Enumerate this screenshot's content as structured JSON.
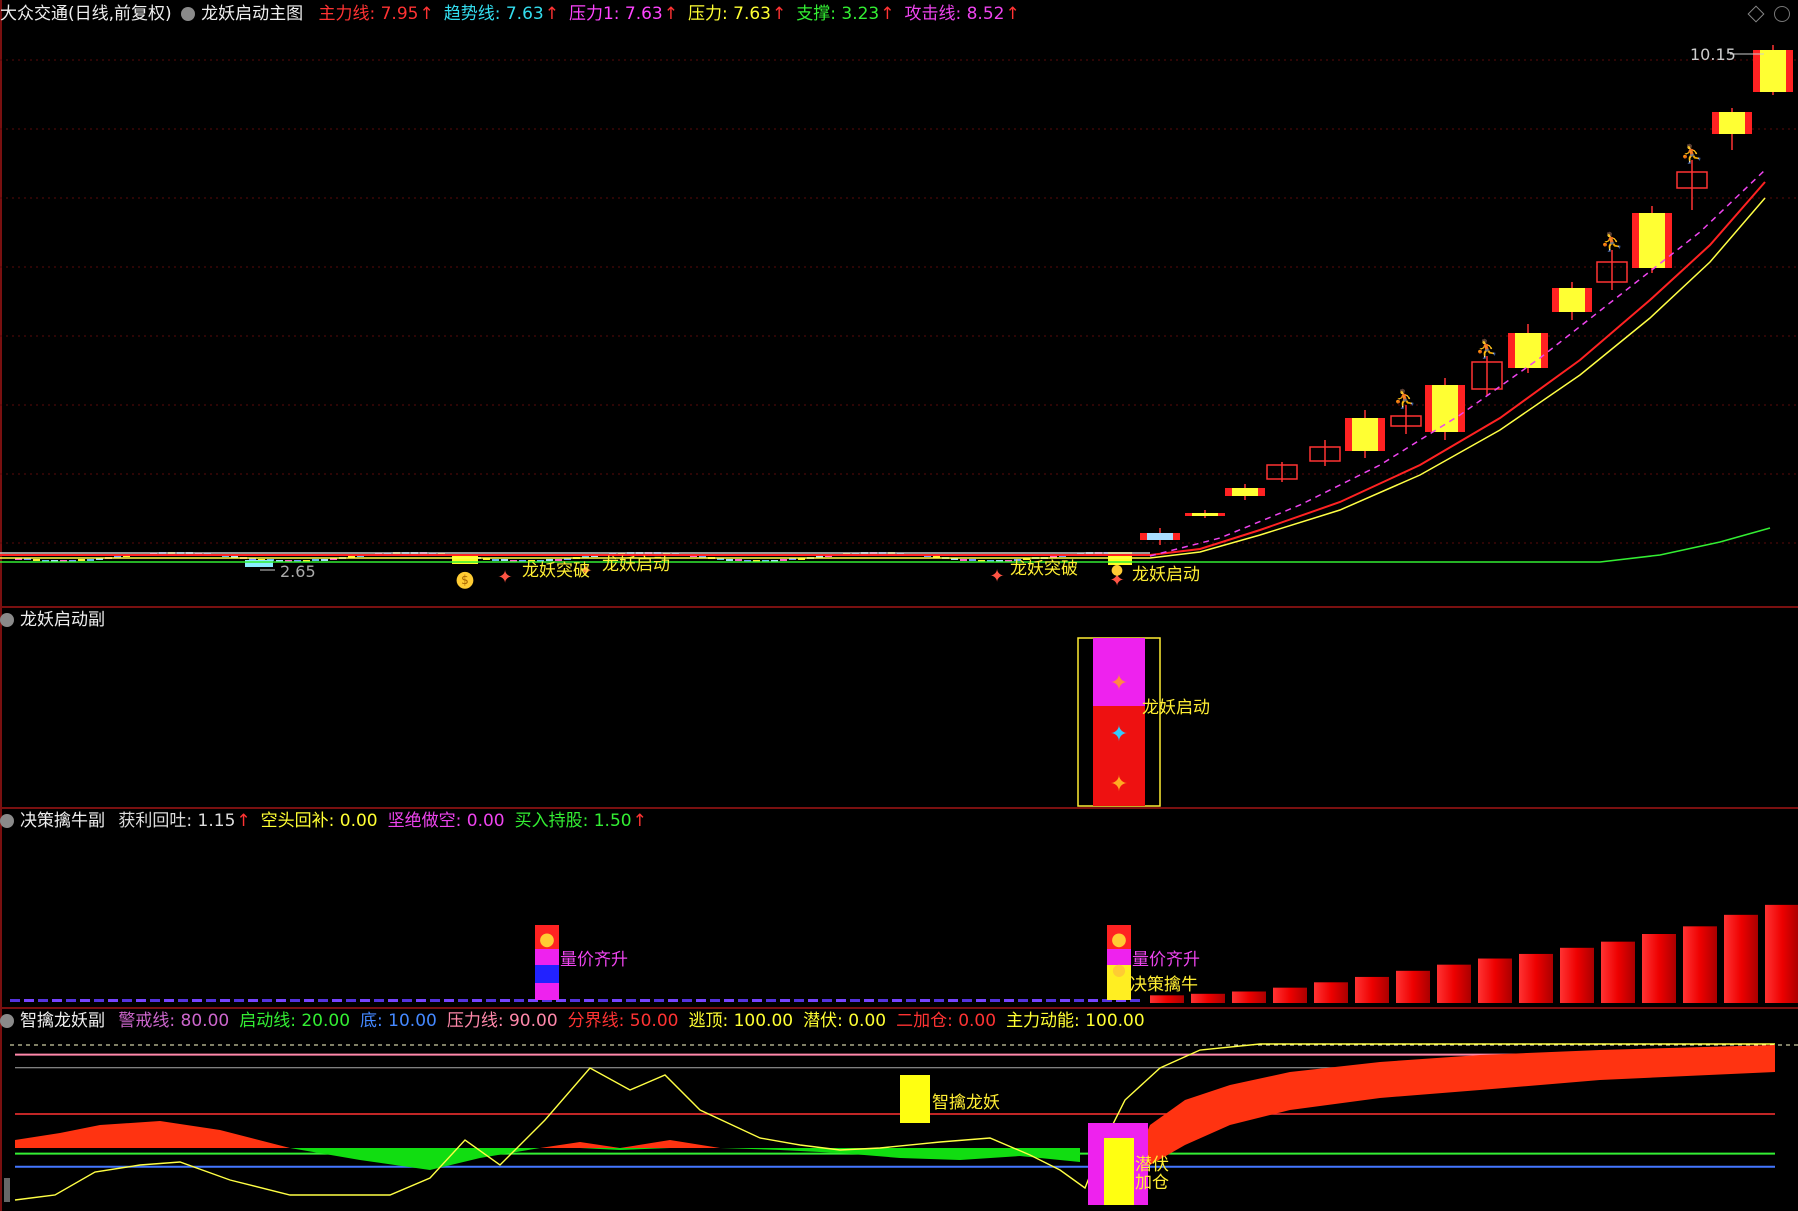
{
  "main": {
    "title": "大众交通(日线,前复权)",
    "indicator": "龙妖启动主图",
    "readouts": [
      {
        "label": "主力线:",
        "value": "7.95",
        "color": "#ff3333"
      },
      {
        "label": "趋势线:",
        "value": "7.63",
        "color": "#33ddee"
      },
      {
        "label": "压力1:",
        "value": "7.63",
        "color": "#ff44ff"
      },
      {
        "label": "压力:",
        "value": "7.63",
        "color": "#ffff33"
      },
      {
        "label": "支撑:",
        "value": "3.23",
        "color": "#33ee33"
      },
      {
        "label": "攻击线:",
        "value": "8.52",
        "color": "#ee44ee"
      }
    ],
    "up_arrow": "↑",
    "high_label": "10.15",
    "low_label": "2.65",
    "signals": [
      "龙妖突破",
      "龙妖启动",
      "龙妖突破",
      "龙妖启动"
    ]
  },
  "sub1": {
    "title": "龙妖启动副",
    "signal": "龙妖启动"
  },
  "sub2": {
    "title": "决策擒牛副",
    "readouts": [
      {
        "label": "获利回吐:",
        "value": "1.15",
        "color": "#dddddd"
      },
      {
        "label": "空头回补:",
        "value": "0.00",
        "color": "#ffff33"
      },
      {
        "label": "坚绝做空:",
        "value": "0.00",
        "color": "#ee44ee"
      },
      {
        "label": "买入持股:",
        "value": "1.50",
        "color": "#33ee33"
      }
    ],
    "signals": [
      "量价齐升",
      "量价齐升",
      "决策擒牛"
    ],
    "bar_values": [
      0.1,
      0.12,
      0.15,
      0.2,
      0.27,
      0.34,
      0.42,
      0.5,
      0.58,
      0.64,
      0.72,
      0.8,
      0.9,
      1.0,
      1.15,
      1.28,
      1.38,
      1.5
    ]
  },
  "sub3": {
    "title": "智擒龙妖副",
    "readouts": [
      {
        "label": "警戒线:",
        "value": "80.00",
        "color": "#cc66cc"
      },
      {
        "label": "启动线:",
        "value": "20.00",
        "color": "#33ee33"
      },
      {
        "label": "底:",
        "value": "10.00",
        "color": "#4488ff"
      },
      {
        "label": "压力线:",
        "value": "90.00",
        "color": "#ff88aa"
      },
      {
        "label": "分界线:",
        "value": "50.00",
        "color": "#ff3333"
      },
      {
        "label": "逃顶:",
        "value": "100.00",
        "color": "#ffff33"
      },
      {
        "label": "潜伏:",
        "value": "0.00",
        "color": "#ffff33"
      },
      {
        "label": "二加仓:",
        "value": "0.00",
        "color": "#ff3333"
      },
      {
        "label": "主力动能:",
        "value": "100.00",
        "color": "#ffff33"
      }
    ],
    "signals": [
      "智擒龙妖",
      "潜伏",
      "加仓"
    ]
  }
}
